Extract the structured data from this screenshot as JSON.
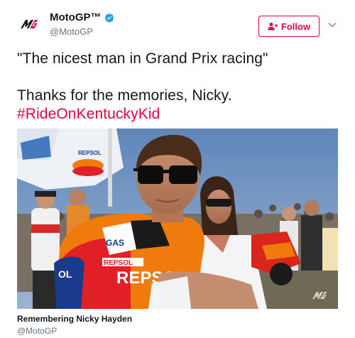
{
  "author": {
    "display_name": "MotoGP™",
    "handle": "@MotoGP",
    "verified": true,
    "avatar_icon": "motogp-logo-icon"
  },
  "actions": {
    "follow_label": "Follow",
    "follow_icon": "add-user-icon",
    "menu_icon": "chevron-down-icon"
  },
  "tweet": {
    "line1": "\"The nicest man in Grand Prix racing\"",
    "line2": "Thanks for the memories, Nicky.",
    "hashtag": "#RideOnKentuckyKid"
  },
  "media": {
    "card_title": "Remembering Nicky Hayden",
    "card_handle": "@MotoGP",
    "watermark_icon": "motogp-logo-icon",
    "logo_text": "REPSOL"
  },
  "colors": {
    "brand_accent": "#e6003d",
    "text_primary": "#14171a",
    "text_secondary": "#657786",
    "verified": "#1da1f2"
  }
}
